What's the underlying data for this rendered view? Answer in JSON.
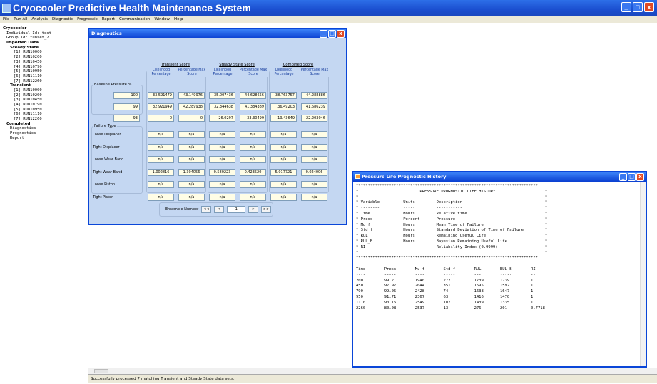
{
  "app": {
    "title": "Cryocooler Predictive Health Maintenance System",
    "min": "_",
    "max": "□",
    "close": "x"
  },
  "menu": [
    "File",
    "Run All",
    "Analysis",
    "Diagnostic",
    "Prognostic",
    "Report",
    "Communication",
    "Window",
    "Help"
  ],
  "tree": [
    {
      "t": "Cryocooler",
      "b": true,
      "i": 0
    },
    {
      "t": "Individual Id: test",
      "b": false,
      "i": 1
    },
    {
      "t": "Group Id: tunset_2",
      "b": false,
      "i": 1
    },
    {
      "t": "Imported Data",
      "b": true,
      "i": 1
    },
    {
      "t": "Steady State",
      "b": true,
      "i": 2
    },
    {
      "t": "[1] RUN10000",
      "b": false,
      "i": 3
    },
    {
      "t": "[2] RUN10200",
      "b": false,
      "i": 3
    },
    {
      "t": "[3] RUN10450",
      "b": false,
      "i": 3
    },
    {
      "t": "[4] RUN10790",
      "b": false,
      "i": 3
    },
    {
      "t": "[5] RUN10950",
      "b": false,
      "i": 3
    },
    {
      "t": "[6] RUN11110",
      "b": false,
      "i": 3
    },
    {
      "t": "[7] RUN12260",
      "b": false,
      "i": 3
    },
    {
      "t": "Transient",
      "b": true,
      "i": 2
    },
    {
      "t": "[1] RUN10000",
      "b": false,
      "i": 3
    },
    {
      "t": "[2] RUN10200",
      "b": false,
      "i": 3
    },
    {
      "t": "[3] RUN10450",
      "b": false,
      "i": 3
    },
    {
      "t": "[4] RUN10790",
      "b": false,
      "i": 3
    },
    {
      "t": "[5] RUN10950",
      "b": false,
      "i": 3
    },
    {
      "t": "[6] RUN11110",
      "b": false,
      "i": 3
    },
    {
      "t": "[7] RUN12260",
      "b": false,
      "i": 3
    },
    {
      "t": "Completed",
      "b": true,
      "i": 1
    },
    {
      "t": "Diagnostics",
      "b": false,
      "i": 2
    },
    {
      "t": "Prognostics",
      "b": false,
      "i": 2
    },
    {
      "t": "Report",
      "b": false,
      "i": 2
    }
  ],
  "diagnostics": {
    "title": "Diagnostics",
    "score_groups": [
      "Transient Score",
      "Steady State Score",
      "Combined Score"
    ],
    "col_headers": [
      "Likelihood Percentage",
      "Percentage Max Score",
      "Likelihood Percentage",
      "Percentage Max Score",
      "Likelihood Percentage",
      "Percentage Max Score"
    ],
    "baseline_label": "Baseline Pressure %",
    "baseline_rows": [
      {
        "p": "100",
        "v": [
          "33.591479",
          "43.149976",
          "35.007436",
          "44.628656",
          "38.763757",
          "44.288886"
        ]
      },
      {
        "p": "99",
        "v": [
          "32.921949",
          "42.289938",
          "32.344638",
          "41.384389",
          "36.49203",
          "41.686239"
        ]
      },
      {
        "p": "93",
        "v": [
          "0",
          "0",
          "26.0297",
          "33.30499",
          "19.43649",
          "22.203046"
        ]
      }
    ],
    "failure_label": "Failure Type",
    "failure_rows": [
      {
        "n": "Loose Displacer",
        "v": [
          "n/a",
          "n/a",
          "n/a",
          "n/a",
          "n/a",
          "n/a"
        ]
      },
      {
        "n": "Tight Displacer",
        "v": [
          "n/a",
          "n/a",
          "n/a",
          "n/a",
          "n/a",
          "n/a"
        ]
      },
      {
        "n": "Loose Wear Band",
        "v": [
          "n/a",
          "n/a",
          "n/a",
          "n/a",
          "n/a",
          "n/a"
        ]
      },
      {
        "n": "Tight Wear Band",
        "v": [
          "1.002816",
          "1.304056",
          "0.580223",
          "0.423520",
          "5.017721",
          "0.024006"
        ]
      },
      {
        "n": "Loose Piston",
        "v": [
          "n/a",
          "n/a",
          "n/a",
          "n/a",
          "n/a",
          "n/a"
        ]
      },
      {
        "n": "Tight Piston",
        "v": [
          "n/a",
          "n/a",
          "n/a",
          "n/a",
          "n/a",
          "n/a"
        ]
      }
    ],
    "ensemble_label": "Ensemble Number",
    "ensemble_value": "1",
    "nav": {
      "first": "<<",
      "prev": "<",
      "next": ">",
      "last": ">>"
    }
  },
  "plh": {
    "title": "Pressure Life Prognostic History",
    "text": "*****************************************************************************\n*                          PRESSURE PROGNOSTIC LIFE HISTORY                     *\n*                                                                               *\n* Variable          Units         Description                                   *\n* --------          -----         -----------                                   *\n* Time              Hours         Relative time                                 *\n* Press             Percent       Pressure                                      *\n* Mu_f              Hours         Mean Time of Failure                          *\n* Std_f             Hours         Standard Deviation of Time of Failure         *\n* RUL               Hours         Remaining Useful Life                         *\n* RUL_B             Hours         Bayesian Remaining Useful Life                *\n* RI                -             Reliability Index (0.9999)                    *\n*                                                                               *\n*****************************************************************************\n\nTime        Press        Mu_f        Std_f        RUL        RUL_B        RI\n----        -----        ----        -----        ---        -----        --\n200         99.2         1940        272          1739       1739         1\n450         97.97        2044        351          1595       1592         1\n790         99.05        2428        74           1638       1647         1\n950         91.71        2367        63           1416       1470         1\n1110        90.16        2549        107          1439       1335         1\n2260        80.08        2537        13           276        201          0.7718"
  },
  "status": "Successfully processed 7 matching Transient and Steady State data sets."
}
